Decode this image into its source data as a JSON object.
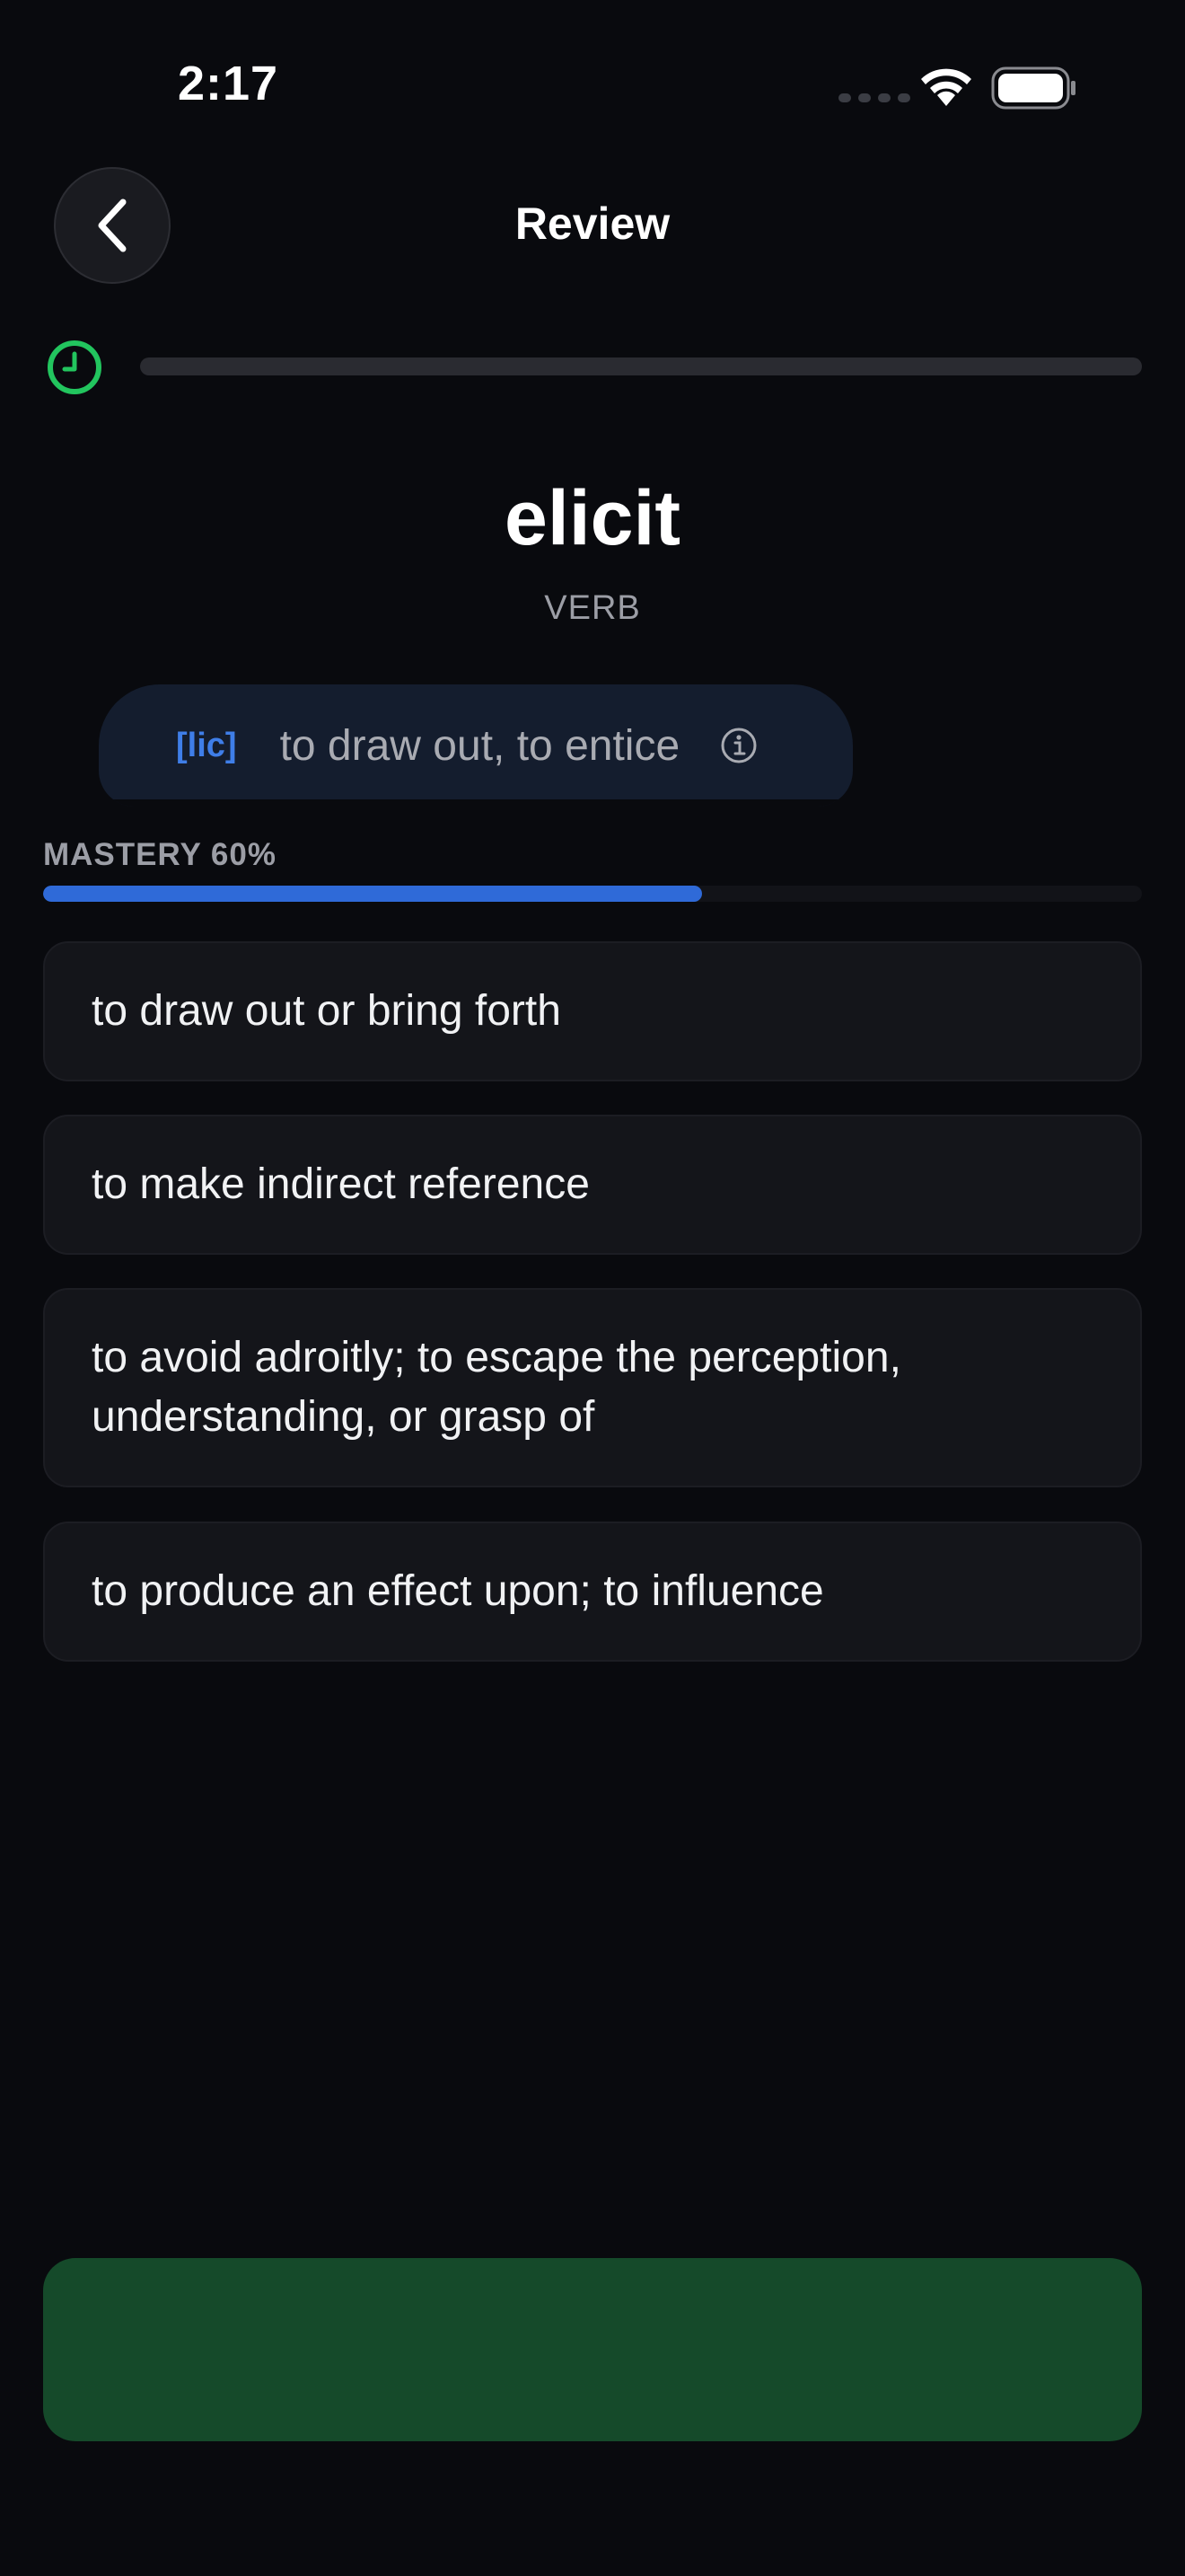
{
  "status_bar": {
    "time": "2:17"
  },
  "header": {
    "title": "Review"
  },
  "timer": {
    "remaining_fraction": 0
  },
  "word": {
    "text": "elicit",
    "part_of_speech": "VERB"
  },
  "root": {
    "tag": "[lic]",
    "meaning": "to draw out, to entice"
  },
  "mastery": {
    "label": "MASTERY 60%",
    "percent": 60
  },
  "options": [
    "to draw out or bring forth",
    "to make indirect reference",
    "to avoid adroitly; to escape the perception, understanding, or grasp of",
    "to produce an effect upon; to influence"
  ],
  "continue_button": {
    "label": ""
  },
  "colors": {
    "background": "#090a0e",
    "accent_blue": "#2f6ad8",
    "timer_green": "#22c55e",
    "button_green": "#154a2a"
  },
  "icons": {
    "back": "chevron-left-icon",
    "timer": "clock-icon",
    "info": "info-circle-icon"
  }
}
